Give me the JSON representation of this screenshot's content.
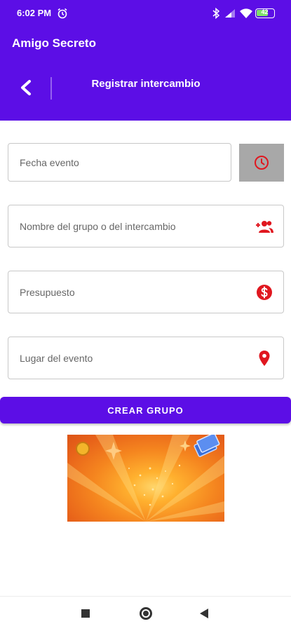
{
  "status_bar": {
    "time": "6:02 PM",
    "battery": "42"
  },
  "app": {
    "title": "Amigo Secreto"
  },
  "screen": {
    "title": "Registrar intercambio"
  },
  "form": {
    "date_placeholder": "Fecha evento",
    "group_name_placeholder": "Nombre del grupo o del intercambio",
    "budget_placeholder": "Presupuesto",
    "location_placeholder": "Lugar del evento"
  },
  "actions": {
    "create_label": "CREAR GRUPO"
  },
  "icons": {
    "back": "chevron-left-icon",
    "clock": "clock-icon",
    "group": "group-add-icon",
    "budget": "dollar-circle-icon",
    "location": "location-pin-icon"
  },
  "colors": {
    "primary": "#5c0ee6",
    "icon_red": "#e0171f",
    "clock_button_bg": "#a8a8a8"
  }
}
